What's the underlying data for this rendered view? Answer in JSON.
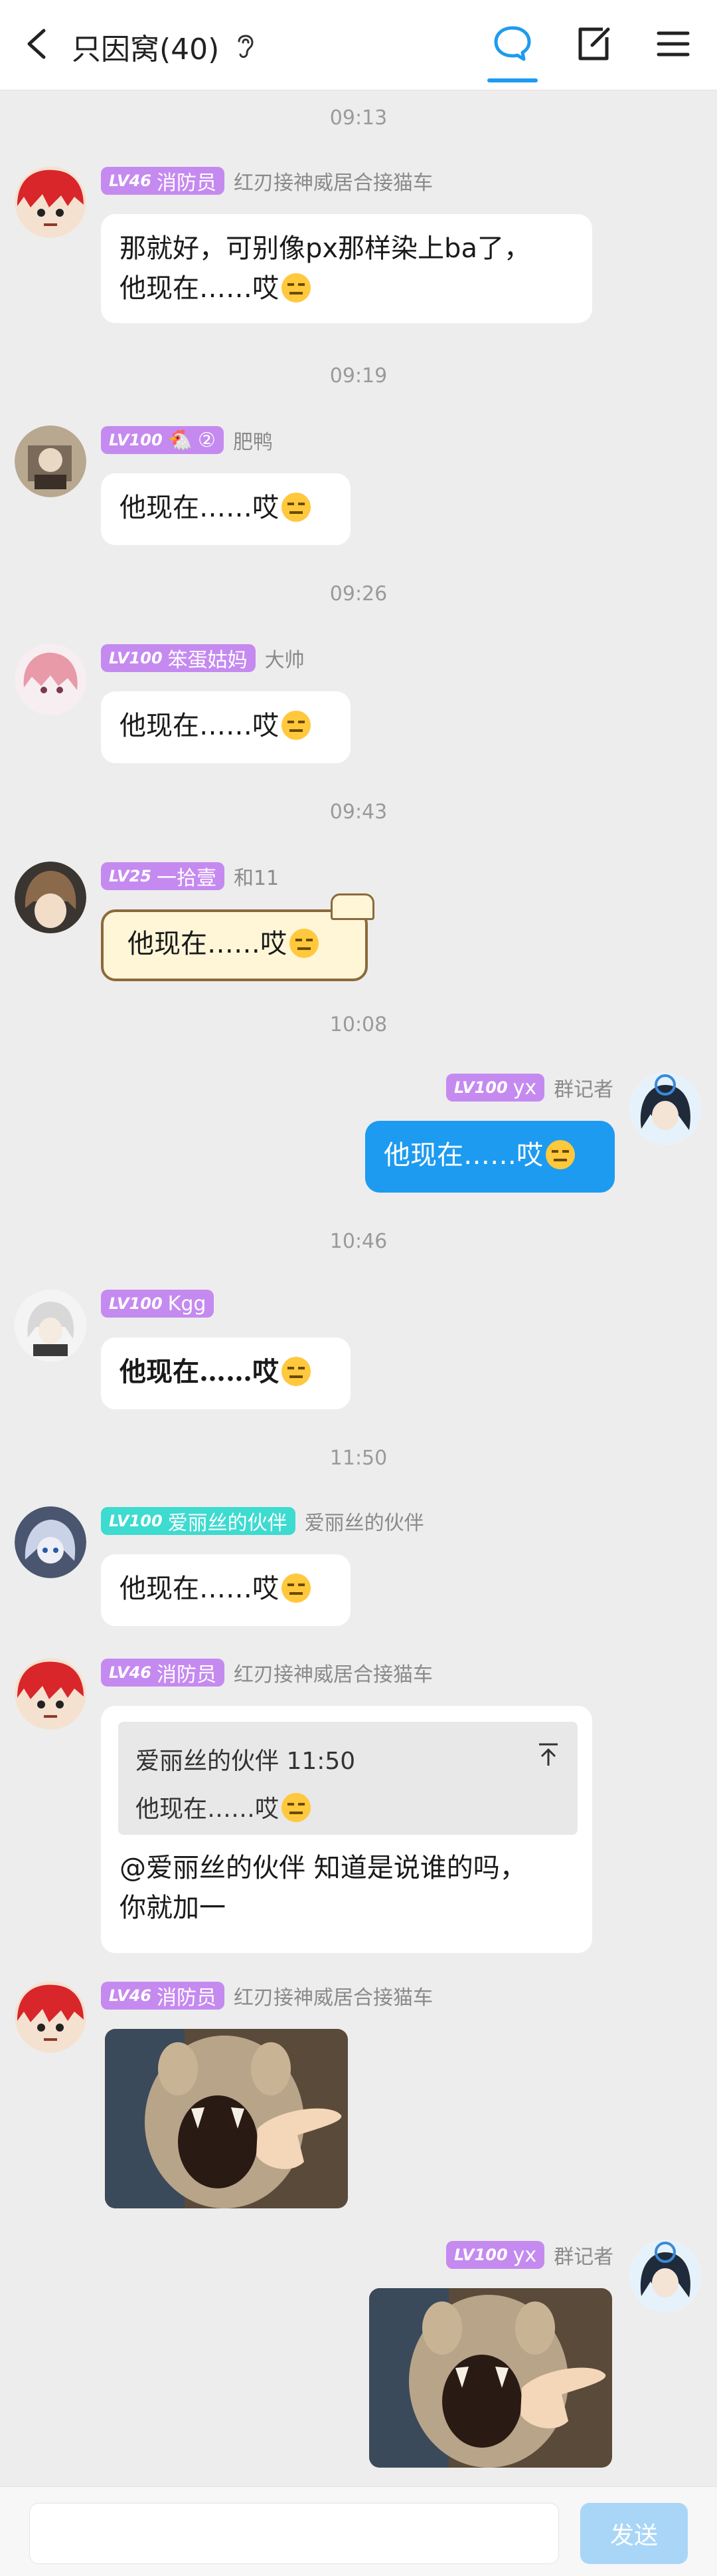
{
  "header": {
    "title": "只因窝(40)"
  },
  "timestamps": [
    "09:13",
    "09:19",
    "09:26",
    "09:43",
    "10:08",
    "10:46",
    "11:50"
  ],
  "messages": [
    {
      "level": "LV46",
      "title": "消防员",
      "nickname": "红刃接神威居合接猫车",
      "text1": "那就好，可别像px那样染上ba了，",
      "text2": "他现在……哎"
    },
    {
      "level": "LV100",
      "title": "②",
      "nickname": "肥鸭",
      "text": "他现在……哎"
    },
    {
      "level": "LV100",
      "title": "笨蛋姑妈",
      "nickname": "大帅",
      "text": "他现在……哎"
    },
    {
      "level": "LV25",
      "title": "一拾壹",
      "nickname": "和11",
      "text": "他现在……哎"
    },
    {
      "level": "LV100",
      "title": "yx",
      "nickname": "群记者",
      "text": "他现在……哎"
    },
    {
      "level": "LV100",
      "title": "Kgg",
      "nickname": "",
      "text": "他现在……哎"
    },
    {
      "level": "LV100",
      "title": "爱丽丝的伙伴",
      "nickname": "爱丽丝的伙伴",
      "text": "他现在……哎"
    },
    {
      "level": "LV46",
      "title": "消防员",
      "nickname": "红刃接神威居合接猫车",
      "quote_header": "爱丽丝的伙伴 11:50",
      "quote_text": "他现在……哎",
      "text1": "@爱丽丝的伙伴 知道是说谁的吗，",
      "text2": "你就加一"
    },
    {
      "level": "LV46",
      "title": "消防员",
      "nickname": "红刃接神威居合接猫车"
    },
    {
      "level": "LV100",
      "title": "yx",
      "nickname": "群记者"
    }
  ],
  "input": {
    "placeholder": "",
    "send_label": "发送"
  },
  "colors": {
    "accent": "#1d9bf0",
    "badge_purple": "#c58af0",
    "badge_teal": "#3ddbd0"
  }
}
